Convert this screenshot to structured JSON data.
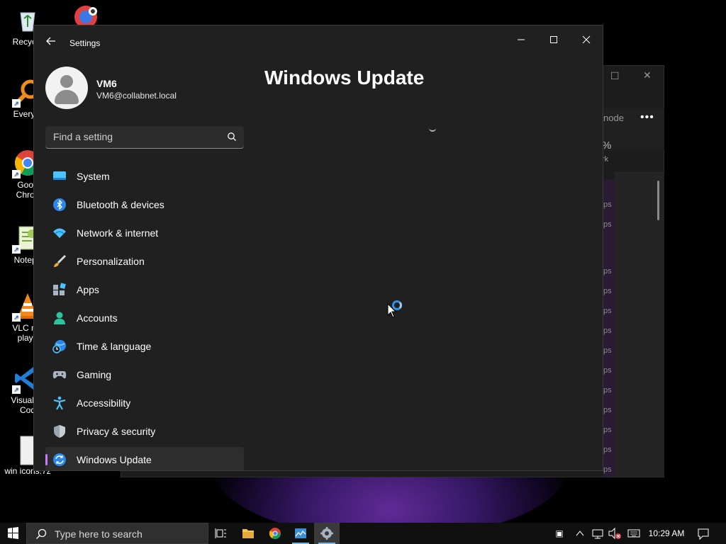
{
  "desktop": {
    "icons": [
      {
        "label": "Recycle",
        "icon": "recycle-bin-icon"
      },
      {
        "label": "Everyth",
        "icon": "everything-search-icon"
      },
      {
        "label": "Goog Chron",
        "icon": "chrome-icon"
      },
      {
        "label": "Notepa",
        "icon": "notepad-plus-icon"
      },
      {
        "label": "VLC me playe",
        "icon": "vlc-icon"
      },
      {
        "label": "Visual St Cod",
        "icon": "vscode-icon"
      },
      {
        "label": "win icons.7z",
        "icon": "archive-icon"
      }
    ]
  },
  "background_window": {
    "toolbar_text": "node",
    "percent": "%",
    "percent_sub": "rk",
    "row_label": "ps"
  },
  "settings": {
    "app_title": "Settings",
    "user": {
      "name": "VM6",
      "email": "VM6@collabnet.local"
    },
    "search": {
      "placeholder": "Find a setting"
    },
    "nav": [
      {
        "label": "System",
        "icon": "system-icon",
        "selected": false
      },
      {
        "label": "Bluetooth & devices",
        "icon": "bluetooth-icon",
        "selected": false
      },
      {
        "label": "Network & internet",
        "icon": "wifi-icon",
        "selected": false
      },
      {
        "label": "Personalization",
        "icon": "brush-icon",
        "selected": false
      },
      {
        "label": "Apps",
        "icon": "apps-icon",
        "selected": false
      },
      {
        "label": "Accounts",
        "icon": "accounts-icon",
        "selected": false
      },
      {
        "label": "Time & language",
        "icon": "time-language-icon",
        "selected": false
      },
      {
        "label": "Gaming",
        "icon": "gaming-icon",
        "selected": false
      },
      {
        "label": "Accessibility",
        "icon": "accessibility-icon",
        "selected": false
      },
      {
        "label": "Privacy & security",
        "icon": "shield-icon",
        "selected": false
      },
      {
        "label": "Windows Update",
        "icon": "windows-update-icon",
        "selected": true
      }
    ],
    "page_title": "Windows Update"
  },
  "taskbar": {
    "search_placeholder": "Type here to search",
    "clock": "10:29 AM"
  },
  "colors": {
    "accent": "#c879ff",
    "window_bg": "#202020",
    "taskbar_bg": "#101010"
  }
}
